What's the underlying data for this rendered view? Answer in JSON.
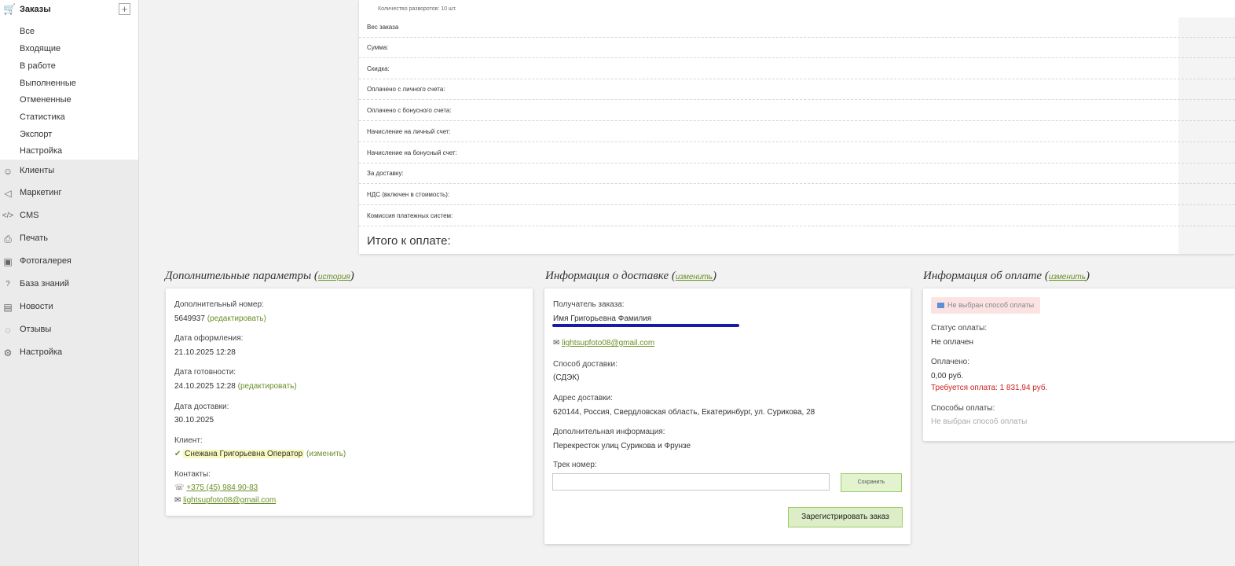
{
  "sidebar": {
    "orders": {
      "label": "Заказы",
      "icon": "cart-icon",
      "add_label": "+",
      "items": [
        "Все",
        "Входящие",
        "В работе",
        "Выполненные",
        "Отмененные",
        "Статистика",
        "Экспорт",
        "Настройка"
      ]
    },
    "nav": [
      {
        "label": "Клиенты",
        "icon": "clients-icon",
        "glyph": "☺"
      },
      {
        "label": "Маркетинг",
        "icon": "megaphone-icon",
        "glyph": "◁"
      },
      {
        "label": "CMS",
        "icon": "code-icon",
        "glyph": "</>"
      },
      {
        "label": "Печать",
        "icon": "printer-icon",
        "glyph": "⎙"
      },
      {
        "label": "Фотогалерея",
        "icon": "gallery-icon",
        "glyph": "▣"
      },
      {
        "label": "База знаний",
        "icon": "knowledge-icon",
        "glyph": "?"
      },
      {
        "label": "Новости",
        "icon": "news-icon",
        "glyph": "▤"
      },
      {
        "label": "Отзывы",
        "icon": "reviews-icon",
        "glyph": "◌"
      },
      {
        "label": "Настройка",
        "icon": "settings-icon",
        "glyph": "⚙"
      }
    ]
  },
  "summary": {
    "spreads": "Количество разворотов: 10 шт.",
    "rows": [
      "Вес заказа",
      "Сумма:",
      "Скидка:",
      "Оплачено с личного счета:",
      "Оплачено с бонусного счета:",
      "Начисление на личный счет:",
      "Начисление на бонусный счет:",
      "За доставку:",
      "НДС (включен в стоимость):",
      "Комиссия платежных систем:"
    ],
    "total_label": "Итого к оплате:"
  },
  "extra": {
    "title": "Дополнительные параметры",
    "history_link": "история",
    "extra_number_label": "Дополнительный номер:",
    "extra_number": "5649937",
    "edit_link": "редактировать",
    "created_label": "Дата оформления:",
    "created": "21.10.2025 12:28",
    "ready_label": "Дата готовности:",
    "ready": "24.10.2025 12:28",
    "delivery_date_label": "Дата доставки:",
    "delivery_date": "30.10.2025",
    "client_label": "Клиент:",
    "client_name": "Снежана Григорьевна Оператор",
    "change_link": "изменить",
    "contacts_label": "Контакты:",
    "phone": "+375 (45) 984 90-83",
    "email": "lightsupfoto08@gmail.com"
  },
  "delivery": {
    "title": "Информация о доставке",
    "change_link": "изменить",
    "recipient_label": "Получатель заказа:",
    "recipient": "Имя Григорьевна Фамилия",
    "email": "lightsupfoto08@gmail.com",
    "method_label": "Способ доставки:",
    "method": "(СДЭК)",
    "address_label": "Адрес доставки:",
    "address": "620144, Россия, Свердловская область, Екатеринбург, ул. Сурикова, 28",
    "info_label": "Дополнительная информация:",
    "info": "Перекресток улиц Сурикова и Фрунзе",
    "track_label": "Трек номер:",
    "track_value": "",
    "save_label": "Сохранить",
    "register_label": "Зарегистрировать заказ"
  },
  "payment": {
    "title": "Информация об оплате",
    "change_link": "изменить",
    "badge": "Не выбран способ оплаты",
    "status_label": "Статус оплаты:",
    "status": "Не оплачен",
    "paid_label": "Оплачено:",
    "paid": "0,00 руб.",
    "required": "Требуется оплата: 1 831,94 руб.",
    "methods_label": "Способы оплаты:",
    "methods": "Не выбран способ оплаты"
  },
  "colors": {
    "accent_green": "#6a8f27",
    "warning_red": "#cc2222",
    "badge_pink": "#fbe3e3",
    "scribble_blue": "#1a1aa8"
  }
}
